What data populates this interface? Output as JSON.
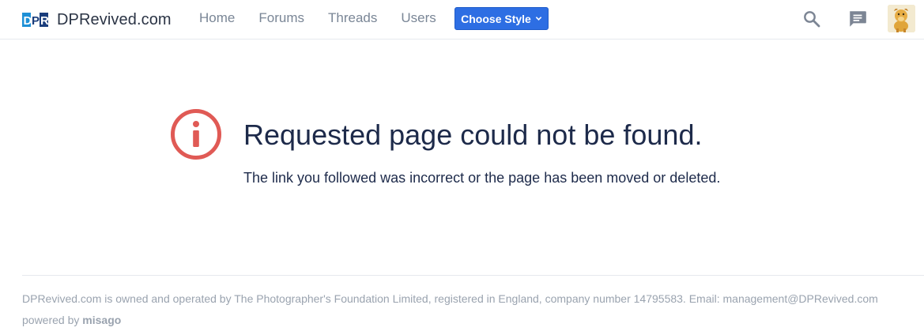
{
  "header": {
    "brand": {
      "logo_text": "DPR",
      "name": "DPRevived.com"
    },
    "nav": [
      {
        "label": "Home"
      },
      {
        "label": "Forums"
      },
      {
        "label": "Threads"
      },
      {
        "label": "Users"
      }
    ],
    "style_button": {
      "label": "Choose Style"
    },
    "icons": [
      "search-icon",
      "chat-icon",
      "avatar"
    ]
  },
  "error": {
    "icon": "info-circle-icon",
    "title": "Requested page could not be found.",
    "message": "The link you followed was incorrect or the page has been moved or deleted."
  },
  "footer": {
    "ownership": "DPRevived.com is owned and operated by The Photographer's Foundation Limited, registered in England, company number 14795583. Email: management@DPRevived.com",
    "powered_prefix": "powered by",
    "powered_link": "misago"
  },
  "colors": {
    "accent": "#2d6ee3",
    "error_icon": "#e05a55",
    "logo_blue": "#1e90d6",
    "text_dark": "#1d2a4a",
    "muted": "#9aa3af"
  }
}
